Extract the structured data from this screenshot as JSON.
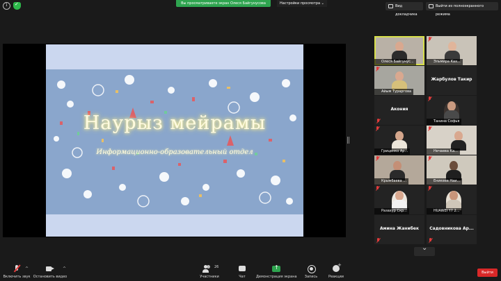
{
  "top_bar": {
    "share_banner": "Вы просматриваете экран Олеся Байгунусова",
    "view_options": "Настройки просмотра",
    "docs_button": "Вид докладчика",
    "exit_fullscreen_button": "Выйти из полноэкранного режима"
  },
  "slide": {
    "title": "Наурыз мейрамы",
    "subtitle": "Информационно-образовательный отдел"
  },
  "gallery": [
    {
      "name": "Олеся Байгунус...",
      "video": true
    },
    {
      "name": "Эльмира Ках...",
      "video": true
    },
    {
      "name": "Айым Тураргова",
      "video": true
    },
    {
      "name": "Жарбулов Такир",
      "video": false
    },
    {
      "name": "Акония",
      "video": false
    },
    {
      "name": "Танина Софья",
      "video": true
    },
    {
      "name": "Гриценко Ар...",
      "video": true
    },
    {
      "name": "Нечаева Ка...",
      "video": true
    },
    {
      "name": "Крымбаева ...",
      "video": true
    },
    {
      "name": "Еникеев Наи...",
      "video": true
    },
    {
      "name": "Разахур Скр...",
      "video": true
    },
    {
      "name": "HUAWEI Y7 2...",
      "video": true
    },
    {
      "name": "Амина Жанибек",
      "video": false
    },
    {
      "name": "Садовникова Ар...",
      "video": false
    }
  ],
  "toolbar": {
    "unmute": "Включить звук",
    "stop_video": "Остановить видео",
    "participants": "Участники",
    "participants_count": "26",
    "chat": "Чат",
    "share_screen": "Демонстрация экрана",
    "record": "Запись",
    "reactions": "Реакции",
    "end": "Выйти"
  },
  "colors": {
    "accent_green": "#2ea44f",
    "end_red": "#d92828",
    "active_speaker": "#d8e04a"
  }
}
